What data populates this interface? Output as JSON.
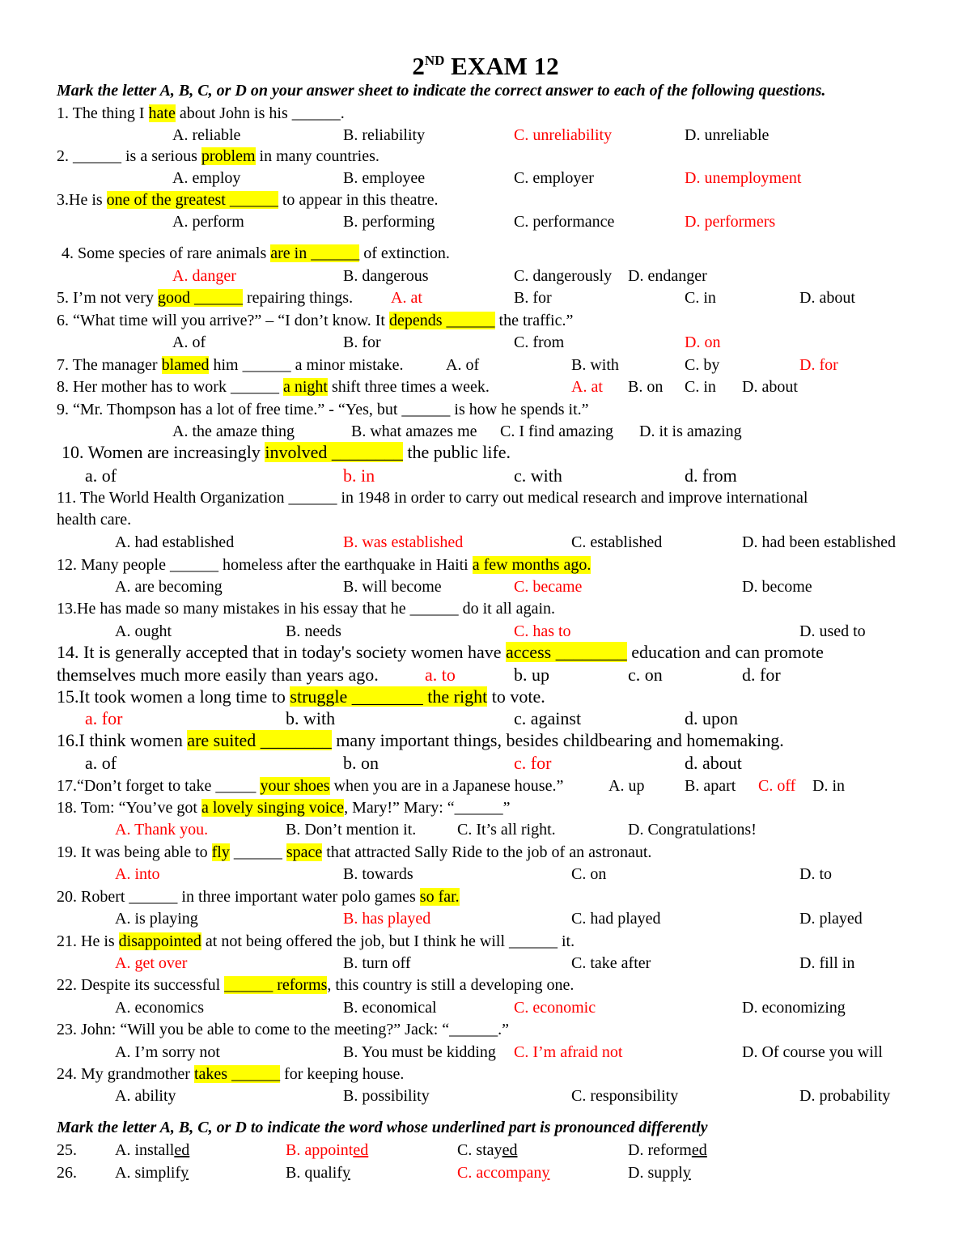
{
  "title": {
    "main": "2",
    "sup": "ND",
    "rest": " EXAM 12"
  },
  "instructions": [
    "Mark the letter A, B, C, or D on your answer sheet to indicate the correct answer to each of the following questions.",
    "Mark the letter A, B, C, or D to indicate the word whose underlined part is pronounced differently"
  ],
  "colors": {
    "correct": "#ff0000",
    "highlight": "#ffff00"
  },
  "q": {
    "1": {
      "a": "1. The thing I ",
      "hl": "hate",
      "b": " about John is his ______.",
      "opts": [
        "A. reliable",
        "B. reliability",
        "C. unreliability",
        "D. unreliable"
      ],
      "answer": "C"
    },
    "2": {
      "a": "2. ______ is a serious ",
      "hl": "problem",
      "b": " in many countries.",
      "opts": [
        "A. employ",
        "B. employee",
        "C. employer",
        "D. unemployment"
      ],
      "answer": "D"
    },
    "3": {
      "a": "3.He is ",
      "hl": "one of the greatest ______",
      "b": " to appear in this theatre.",
      "opts": [
        "A. perform",
        "B. performing",
        "C. performance",
        "D. performers"
      ],
      "answer": "D"
    },
    "4": {
      "a": "4. Some species of rare animals ",
      "hl": "are in ______",
      "b": " of extinction.",
      "opts": [
        "A. danger",
        "B. dangerous",
        "C. dangerously",
        "D. endanger"
      ],
      "answer": "A"
    },
    "5": {
      "a": "5. I’m not very ",
      "hl": "good ______",
      "b": " repairing things.",
      "opts": [
        "A. at",
        "B. for",
        "C. in",
        "D. about"
      ],
      "answer": "A"
    },
    "6": {
      "a": "6. “What time will you arrive?”  – “I don’t know. It ",
      "hl": "depends ______",
      "b": " the traffic.”",
      "opts": [
        "A. of",
        "B. for",
        "C. from",
        "D. on"
      ],
      "answer": "D"
    },
    "7": {
      "a": "7. The manager ",
      "hl": "blamed",
      "b": " him ______ a minor mistake.",
      "opts": [
        "A. of",
        "B. with",
        "C. by",
        "D. for"
      ],
      "answer": "D"
    },
    "8": {
      "a": "8. Her mother has to work ______ ",
      "hl": "a night",
      "b": " shift three times a week.",
      "opts": [
        "A. at",
        "B. on",
        "C. in",
        "D. about"
      ],
      "answer": "A"
    },
    "9": {
      "a": "9. “Mr. Thompson has a lot of free time.”  - “Yes, but ______ is how he spends it.”",
      "opts": [
        "A. the amaze thing",
        "B. what amazes me",
        "C. I find amazing",
        "D. it is amazing"
      ]
    },
    "10": {
      "a": "10. Women are increasingly ",
      "hl": "involved ________",
      "b": " the public life.",
      "opts": [
        "a. of",
        "b. in",
        "c. with",
        "d. from"
      ],
      "answer": "b"
    },
    "11": {
      "a": "11. The World Health Organization ______ in 1948 in order to carry out medical research and improve international",
      "a2": "health care.",
      "opts": [
        "A. had established",
        "B. was established",
        "C. established",
        "D. had been established"
      ],
      "answer": "B"
    },
    "12": {
      "a": "12. Many people ______ homeless after the earthquake in Haiti ",
      "hl": "a few months ago.",
      "opts": [
        "A. are becoming",
        "B. will become",
        "C. became",
        "D. become"
      ],
      "answer": "C"
    },
    "13": {
      "a": "13.He has made so many mistakes in his essay that he ______ do it all again.",
      "opts": [
        "A. ought",
        "B. needs",
        "C. has to",
        "D. used to"
      ],
      "answer": "C"
    },
    "14": {
      "a": "14. It is generally accepted that in today's society women have ",
      "hl": "access ________",
      "b": " education and can promote",
      "a2": "themselves much more easily than years ago.",
      "opts": [
        "a. to",
        "b. up",
        "c. on",
        "d. for"
      ],
      "answer": "a"
    },
    "15": {
      "a": "15.It took women a long time to ",
      "hl": "struggle ________ the right",
      "b": " to vote.",
      "opts": [
        "a. for",
        "b. with",
        "c. against",
        "d. upon"
      ],
      "answer": "a"
    },
    "16": {
      "a": "16.I think women ",
      "hl": "are suited ________",
      "b": " many important things, besides childbearing and homemaking.",
      "opts": [
        "a. of",
        "b. on",
        "c. for",
        "d. about"
      ],
      "answer": "c"
    },
    "17": {
      "a": "17.“Don’t forget to take _____ ",
      "hl": "your shoes",
      "b": " when you are in a Japanese house.”",
      "opts": [
        "A. up",
        "B. apart",
        "C. off",
        "D. in"
      ],
      "answer": "C"
    },
    "18": {
      "a": "18. Tom: “You’ve got ",
      "hl": "a lovely singing voice",
      "b": ", Mary!”      Mary: “______”",
      "opts": [
        "A. Thank you.",
        "B. Don’t mention it.",
        "C. It’s all right.",
        "D. Congratulations!"
      ],
      "answer": "A"
    },
    "19": {
      "a": "19. It was being able to ",
      "hl": "fly",
      "m": " ______ ",
      "hl2": "space",
      "b": " that attracted Sally Ride to the job of an astronaut.",
      "opts": [
        "A. into",
        "B. towards",
        "C. on",
        "D. to"
      ],
      "answer": "A"
    },
    "20": {
      "a": "20. Robert ______ in three important water polo games ",
      "hl": "so far.",
      "opts": [
        "A. is playing",
        "B. has played",
        "C. had played",
        "D. played"
      ],
      "answer": "B"
    },
    "21": {
      "a": "21. He is ",
      "hl": "disappointed",
      "b": " at not being offered the job, but I think he will ______ it.",
      "opts": [
        "A. get over",
        "B. turn off",
        "C. take after",
        "D. fill in"
      ],
      "answer": "A"
    },
    "22": {
      "a": "22. Despite its successful ",
      "hl": "______ reforms",
      "b": ", this country is still a developing one.",
      "opts": [
        "A. economics",
        "B. economical",
        "C. economic",
        "D. economizing"
      ],
      "answer": "C"
    },
    "23": {
      "a": "23. John: “Will you be able to come to the meeting?”  Jack: “______.”",
      "opts": [
        "A. I’m sorry not",
        "B. You must be kidding",
        "C. I’m afraid not",
        "D. Of course you will"
      ],
      "answer": "C"
    },
    "24": {
      "a": "24. My grandmother ",
      "hl": "takes ______",
      "b": " for keeping house.",
      "opts": [
        "A. ability",
        "B. possibility",
        "C. responsibility",
        "D. probability"
      ]
    },
    "25": {
      "num": "25.",
      "opts": [
        [
          "A. install",
          "ed"
        ],
        [
          "B. appoint",
          "ed"
        ],
        [
          "C. stay",
          "ed"
        ],
        [
          "D. reform",
          "ed"
        ]
      ],
      "answer": "B"
    },
    "26": {
      "num": "26.",
      "opts": [
        [
          "A. simplif",
          "y"
        ],
        [
          "B. qualif",
          "y"
        ],
        [
          "C. accompan",
          "y"
        ],
        [
          "D. suppl",
          "y"
        ]
      ],
      "answer": "C"
    }
  }
}
